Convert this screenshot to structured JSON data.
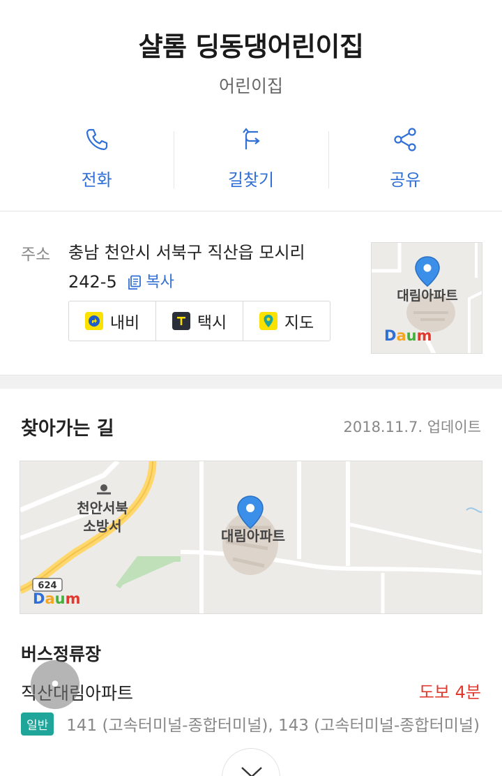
{
  "header": {
    "title": "샬롬 딩동댕어린이집",
    "category": "어린이집"
  },
  "actions": [
    {
      "label": "전화",
      "icon": "phone-icon"
    },
    {
      "label": "길찾기",
      "icon": "directions-icon"
    },
    {
      "label": "공유",
      "icon": "share-icon"
    }
  ],
  "address": {
    "label": "주소",
    "line1": "충남 천안시 서북구 직산읍 모시리",
    "line2": "242-5",
    "copy_label": "복사",
    "nav_buttons": [
      {
        "label": "내비",
        "icon": "navi-icon"
      },
      {
        "label": "택시",
        "icon": "taxi-icon"
      },
      {
        "label": "지도",
        "icon": "map-pin-icon"
      }
    ],
    "mini_map": {
      "label": "대림아파트",
      "logo": "Daum"
    }
  },
  "route": {
    "title": "찾아가는 길",
    "updated": "2018.11.7. 업데이트",
    "map": {
      "labels": [
        "천안서북",
        "소방서",
        "대림아파트"
      ],
      "road_number": "624",
      "logo": "Daum"
    }
  },
  "bus": {
    "heading": "버스정류장",
    "stop_name": "직산대림아파트",
    "walk": "도보 4분",
    "badge": "일반",
    "routes": "141 (고속터미널-종합터미널), 143 (고속터미널-종합터미널)"
  },
  "colors": {
    "accent": "#2f6fd6",
    "walk": "#e03a2f",
    "badge": "#1fa59a"
  }
}
